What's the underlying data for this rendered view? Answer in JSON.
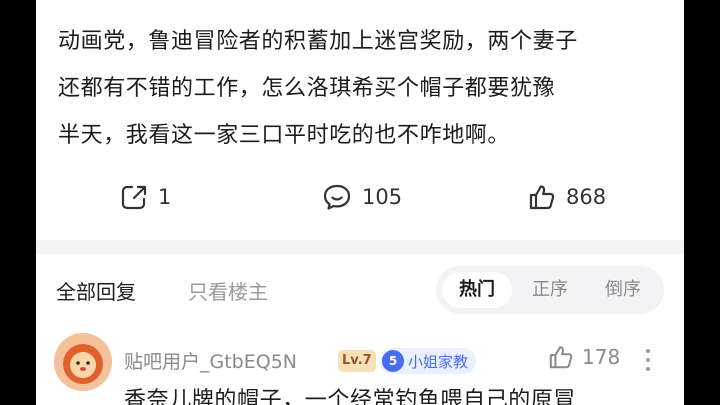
{
  "post": {
    "lines": [
      "动画党，鲁迪冒险者的积蓄加上迷宫奖励，两个妻子",
      "还都有不错的工作，怎么洛琪希买个帽子都要犹豫",
      "半天，我看这一家三口平时吃的也不咋地啊。"
    ]
  },
  "actions": {
    "share_count": "1",
    "comment_count": "105",
    "like_count": "868"
  },
  "replies": {
    "all_label": "全部回复",
    "owner_only_label": "只看楼主",
    "sort_options": [
      "热门",
      "正序",
      "倒序"
    ],
    "active_sort": "热门"
  },
  "comment": {
    "username": "贴吧用户_GtbEQ5N",
    "level": "Lv.7",
    "fan_level": "5",
    "fan_title": "小姐家教",
    "like_count": "178",
    "text": "香奈儿牌的帽子，一个经常钓鱼喂自己的原冒"
  },
  "colors": {
    "accent": "#4a6cf0",
    "text": "#1c1c1c",
    "muted": "#8a8a8a"
  }
}
